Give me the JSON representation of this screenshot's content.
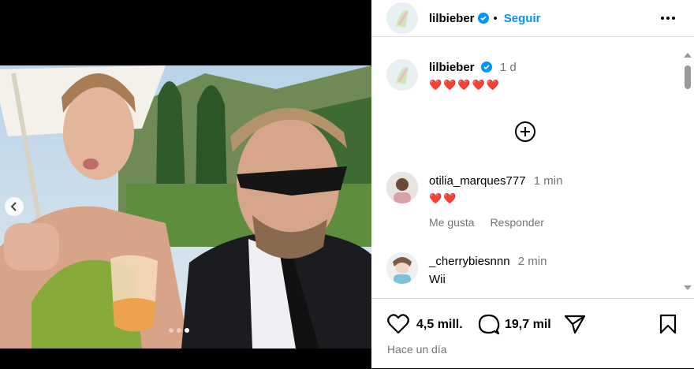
{
  "post": {
    "author": "lilbieber",
    "follow_label": "Seguir",
    "caption_author": "lilbieber",
    "caption_age": "1 d",
    "caption_text": "❤️❤️❤️❤️❤️"
  },
  "carousel": {
    "slides": 3,
    "active_index": 2
  },
  "comments": [
    {
      "user": "otilia_marques777",
      "age": "1 min",
      "text": "❤️❤️",
      "like_label": "Me gusta",
      "reply_label": "Responder"
    },
    {
      "user": "_cherrybiesnnn",
      "age": "2 min",
      "text": "Wii"
    }
  ],
  "stats": {
    "likes": "4,5 mill.",
    "comments": "19,7 mil",
    "posted": "Hace un día"
  },
  "colors": {
    "accent": "#0095f6",
    "verified": "#0095f6",
    "heart": "#e0245e",
    "muted": "#737373"
  },
  "icons": [
    "more-icon",
    "verified-icon",
    "add-comment-icon",
    "like-icon",
    "comment-icon",
    "share-icon",
    "save-icon",
    "chevron-left-icon",
    "scroll-up-icon",
    "scroll-down-icon"
  ]
}
